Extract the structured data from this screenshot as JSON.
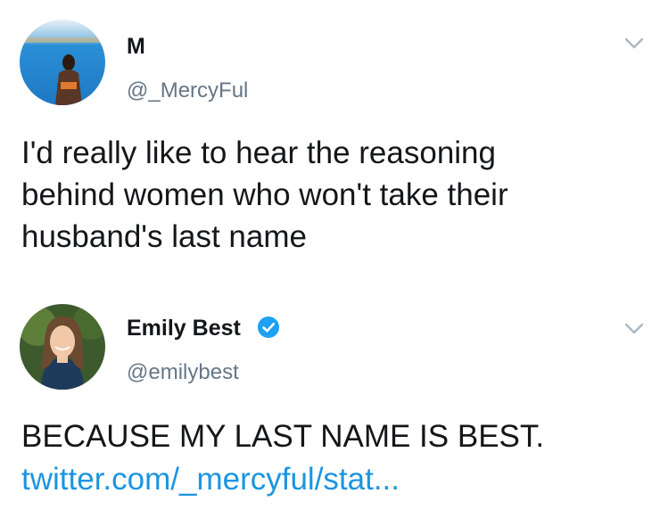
{
  "tweet1": {
    "display_name": "M",
    "handle": "@_MercyFul",
    "text_line1": "I'd really like to hear the reasoning",
    "text_line2": "behind women who won't take their",
    "text_line3": "husband's last name",
    "avatar_icon": "profile-photo-icon",
    "menu_icon": "chevron-down-icon"
  },
  "tweet2": {
    "display_name": "Emily Best",
    "handle": "@emilybest",
    "verified_icon": "verified-badge-icon",
    "text": "BECAUSE MY LAST NAME IS BEST.",
    "link": "twitter.com/_mercyful/stat...",
    "avatar_icon": "profile-photo-icon",
    "menu_icon": "chevron-down-icon"
  },
  "colors": {
    "text": "#14171a",
    "secondary": "#657786",
    "link": "#1b95e0",
    "verified": "#1da1f2",
    "chevron": "#aab8c2"
  }
}
